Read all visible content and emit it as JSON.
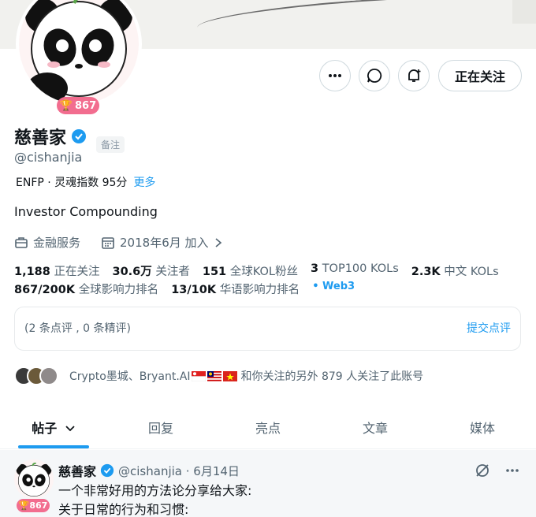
{
  "profile": {
    "name": "慈善家",
    "note_tag": "备注",
    "handle": "@cishanjia",
    "mbti": "ENFP · 灵魂指数 95分",
    "more": "更多",
    "bio": "Investor Compounding",
    "category": "金融服务",
    "joined": "2018年6月 加入",
    "badge": "867"
  },
  "header": {
    "follow_label": "正在关注",
    "icons": [
      "more-icon",
      "message-icon",
      "notify-icon"
    ]
  },
  "stats": {
    "following_count": "1,188",
    "following_label": "正在关注",
    "followers_count": "30.6万",
    "followers_label": "关注者",
    "kol_count": "151",
    "kol_label": "全球KOL粉丝",
    "top_count": "3",
    "top_label": "TOP100 KOLs",
    "cn_count": "2.3K",
    "cn_label": "中文 KOLs",
    "global_rank": "867/200K",
    "global_rank_label": "全球影响力排名",
    "cn_rank": "13/10K",
    "cn_rank_label": "华语影响力排名",
    "tag": "• Web3"
  },
  "review": {
    "summary": "(2 条点评 , 0 条精评)",
    "submit": "提交点评"
  },
  "followed_by": {
    "text_a": "Crypto墨城、Bryant.AI",
    "text_b": "和你关注的另外 879 人关注了此账号"
  },
  "tabs": [
    "帖子",
    "回复",
    "亮点",
    "文章",
    "媒体"
  ],
  "post": {
    "name": "慈善家",
    "handle_date": "@cishanjia · 6月14日",
    "line1": "一个非常好用的方法论分享给大家:",
    "line2": "关于日常的行为和习惯:",
    "badge": "867"
  },
  "colors": {
    "accent": "#1d9bf0",
    "badge": "#f26d8f",
    "text": "#0f1419",
    "muted": "#536471"
  }
}
